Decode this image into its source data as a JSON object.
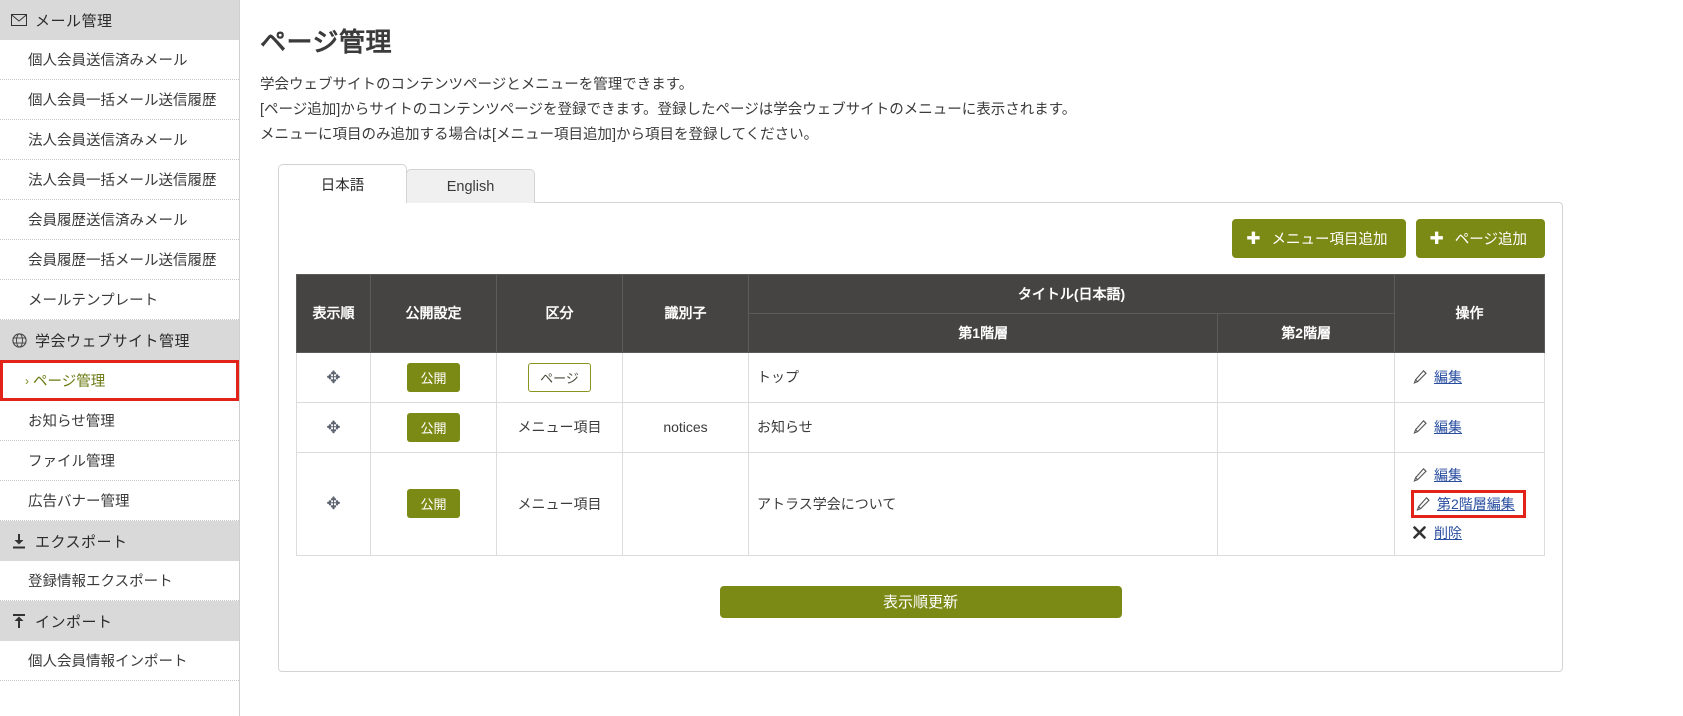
{
  "sidebar": {
    "groups": [
      {
        "icon": "mail-icon",
        "label": "メール管理",
        "items": [
          {
            "label": "個人会員送信済みメール",
            "active": false
          },
          {
            "label": "個人会員一括メール送信履歴",
            "active": false
          },
          {
            "label": "法人会員送信済みメール",
            "active": false
          },
          {
            "label": "法人会員一括メール送信履歴",
            "active": false
          },
          {
            "label": "会員履歴送信済みメール",
            "active": false
          },
          {
            "label": "会員履歴一括メール送信履歴",
            "active": false
          },
          {
            "label": "メールテンプレート",
            "active": false
          }
        ]
      },
      {
        "icon": "globe-icon",
        "label": "学会ウェブサイト管理",
        "items": [
          {
            "label": "ページ管理",
            "active": true,
            "caret": "›"
          },
          {
            "label": "お知らせ管理",
            "active": false
          },
          {
            "label": "ファイル管理",
            "active": false
          },
          {
            "label": "広告バナー管理",
            "active": false
          }
        ]
      },
      {
        "icon": "download-icon",
        "label": "エクスポート",
        "items": [
          {
            "label": "登録情報エクスポート",
            "active": false
          }
        ]
      },
      {
        "icon": "upload-icon",
        "label": "インポート",
        "items": [
          {
            "label": "個人会員情報インポート",
            "active": false
          }
        ]
      }
    ]
  },
  "main": {
    "title": "ページ管理",
    "description": [
      "学会ウェブサイトのコンテンツページとメニューを管理できます。",
      "[ページ追加]からサイトのコンテンツページを登録できます。登録したページは学会ウェブサイトのメニューに表示されます。",
      "メニューに項目のみ追加する場合は[メニュー項目追加]から項目を登録してください。"
    ],
    "tabs": [
      {
        "label": "日本語",
        "active": true
      },
      {
        "label": "English",
        "active": false
      }
    ],
    "buttons": {
      "add_menu_item": "メニュー項目追加",
      "add_page": "ページ追加",
      "plus": "✚",
      "update_order": "表示順更新"
    },
    "table": {
      "headers": {
        "order": "表示順",
        "publish": "公開設定",
        "type": "区分",
        "identifier": "識別子",
        "title_group": "タイトル(日本語)",
        "tier1": "第1階層",
        "tier2": "第2階層",
        "operation": "操作"
      },
      "rows": [
        {
          "handle": "✥",
          "publish": "公開",
          "type": "ページ",
          "type_style": "outline",
          "identifier": "",
          "tier1": "トップ",
          "tier2": "",
          "ops": [
            {
              "label": "編集",
              "icon": "pencil-icon",
              "highlight": false
            }
          ]
        },
        {
          "handle": "✥",
          "publish": "公開",
          "type": "メニュー項目",
          "type_style": "plain",
          "identifier": "notices",
          "tier1": "お知らせ",
          "tier2": "",
          "ops": [
            {
              "label": "編集",
              "icon": "pencil-icon",
              "highlight": false
            }
          ]
        },
        {
          "handle": "✥",
          "publish": "公開",
          "type": "メニュー項目",
          "type_style": "plain",
          "identifier": "",
          "tier1": "アトラス学会について",
          "tier2": "",
          "ops": [
            {
              "label": "編集",
              "icon": "pencil-icon",
              "highlight": false
            },
            {
              "label": "第2階層編集",
              "icon": "pencil-icon",
              "highlight": true
            },
            {
              "label": "削除",
              "icon": "cross-icon",
              "highlight": false
            }
          ]
        }
      ]
    }
  },
  "colors": {
    "accent_olive": "#7b8a15",
    "header_dark": "#464442",
    "highlight_red": "#e2231a",
    "link_blue": "#2b4fa0"
  }
}
